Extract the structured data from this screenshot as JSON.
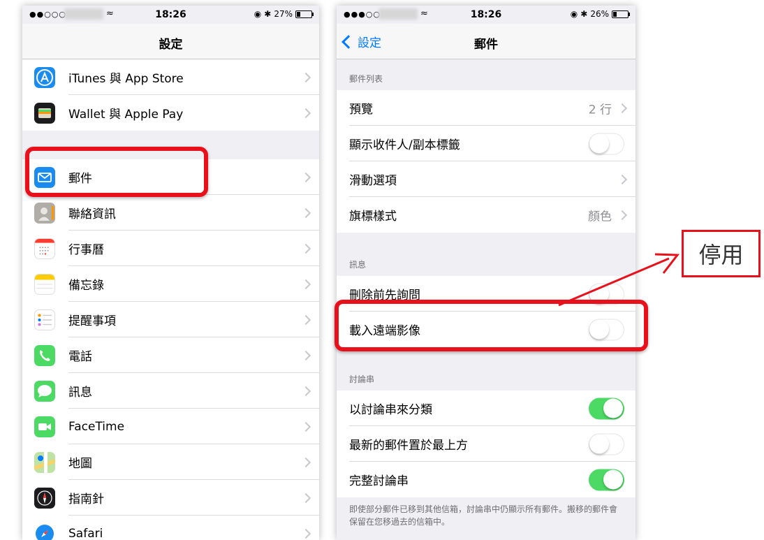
{
  "left_phone": {
    "status": {
      "signal": "●●○○○",
      "time": "18:26",
      "battery": "27%",
      "battery_level": 0.27
    },
    "title": "設定",
    "rows_top": [
      {
        "label": "iTunes 與 App Store",
        "icon": "app-store-icon",
        "color": "#1a8cf0"
      },
      {
        "label": "Wallet 與 Apple Pay",
        "icon": "wallet-icon",
        "color": "#1c1c1e"
      }
    ],
    "rows_main": [
      {
        "label": "郵件",
        "icon": "mail-icon",
        "color": "#1a8cf0"
      },
      {
        "label": "聯絡資訊",
        "icon": "contacts-icon",
        "color": "#b0aca6"
      },
      {
        "label": "行事曆",
        "icon": "calendar-icon",
        "color": "#ffffff"
      },
      {
        "label": "備忘錄",
        "icon": "notes-icon",
        "color": "#ffcc00"
      },
      {
        "label": "提醒事項",
        "icon": "reminders-icon",
        "color": "#ffffff"
      },
      {
        "label": "電話",
        "icon": "phone-icon",
        "color": "#4cd964"
      },
      {
        "label": "訊息",
        "icon": "messages-icon",
        "color": "#4cd964"
      },
      {
        "label": "FaceTime",
        "icon": "facetime-icon",
        "color": "#4cd964"
      },
      {
        "label": "地圖",
        "icon": "maps-icon",
        "color": "#6fb8f2"
      },
      {
        "label": "指南針",
        "icon": "compass-icon",
        "color": "#1c1c1e"
      },
      {
        "label": "Safari",
        "icon": "safari-icon",
        "color": "#1a8cf0"
      }
    ]
  },
  "right_phone": {
    "status": {
      "signal": "●●●○○",
      "time": "18:26",
      "battery": "26%",
      "battery_level": 0.26
    },
    "back_label": "設定",
    "title": "郵件",
    "sections": [
      {
        "header": "郵件列表",
        "rows": [
          {
            "label": "預覽",
            "value": "2 行",
            "type": "disclosure"
          },
          {
            "label": "顯示收件人/副本標籤",
            "type": "switch",
            "on": false
          },
          {
            "label": "滑動選項",
            "type": "disclosure"
          },
          {
            "label": "旗標樣式",
            "value": "顏色",
            "type": "disclosure"
          }
        ]
      },
      {
        "header": "訊息",
        "rows": [
          {
            "label": "刪除前先詢問",
            "type": "switch",
            "on": false
          },
          {
            "label": "載入遠端影像",
            "type": "switch",
            "on": false
          }
        ]
      },
      {
        "header": "討論串",
        "rows": [
          {
            "label": "以討論串來分類",
            "type": "switch",
            "on": true
          },
          {
            "label": "最新的郵件置於最上方",
            "type": "switch",
            "on": false
          },
          {
            "label": "完整討論串",
            "type": "switch",
            "on": true
          }
        ]
      }
    ],
    "footer": "即使部分郵件已移到其他信箱，討論串中仍顯示所有郵件。搬移的郵件會保留在您移過去的信箱中。"
  },
  "annotation": {
    "callout_text": "停用",
    "accent_color": "#e8101a"
  }
}
